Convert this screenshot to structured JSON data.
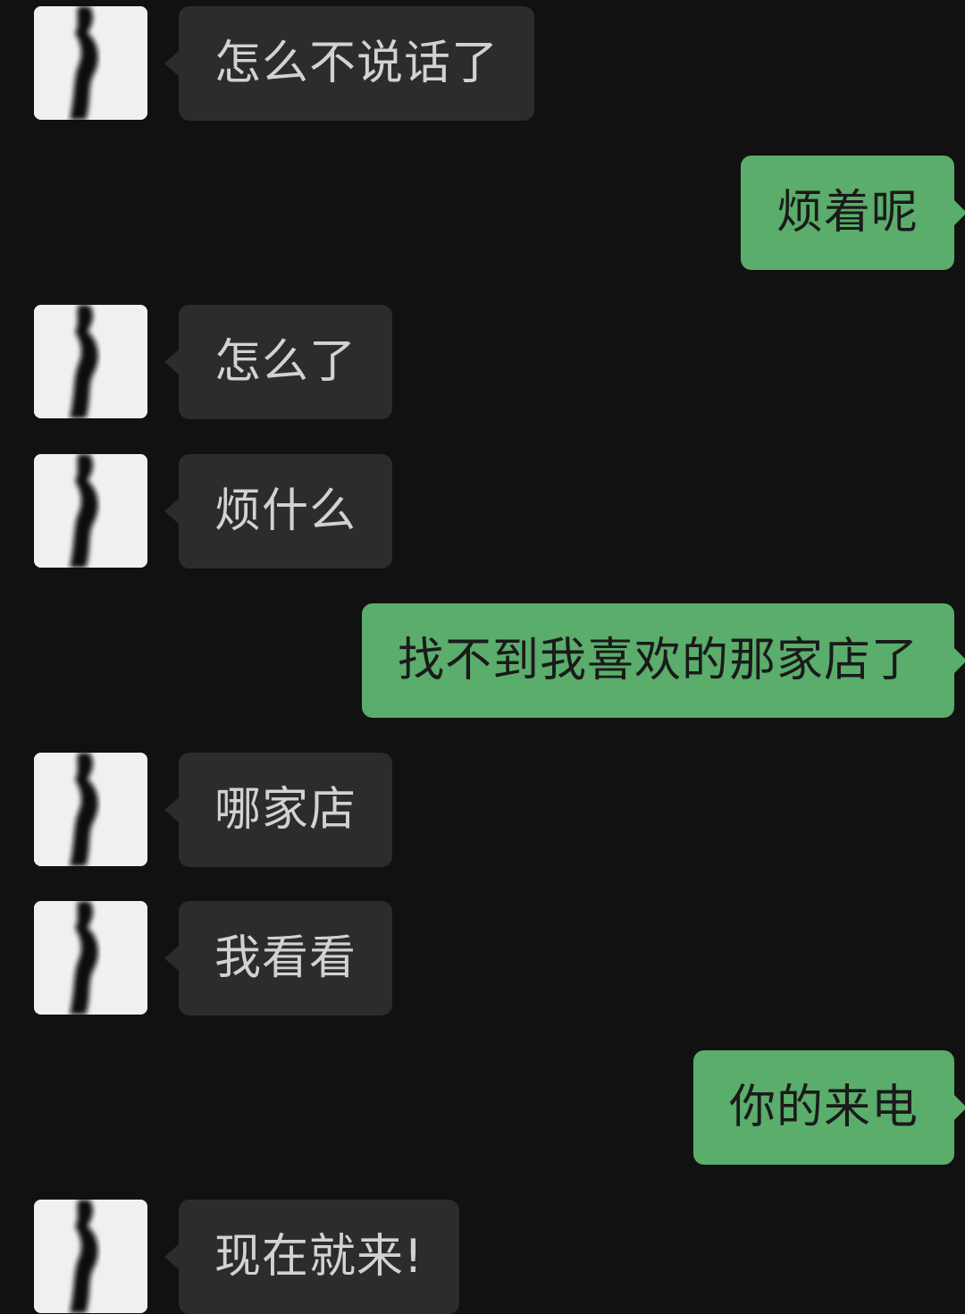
{
  "chat": {
    "messages": [
      {
        "sender": "other",
        "text": "怎么不说话了"
      },
      {
        "sender": "self",
        "text": "烦着呢"
      },
      {
        "sender": "other",
        "text": "怎么了"
      },
      {
        "sender": "other",
        "text": "烦什么"
      },
      {
        "sender": "self",
        "text": "找不到我喜欢的那家店了"
      },
      {
        "sender": "other",
        "text": "哪家店"
      },
      {
        "sender": "other",
        "text": "我看看"
      },
      {
        "sender": "self",
        "text": "你的来电"
      },
      {
        "sender": "other",
        "text": "现在就来!"
      }
    ]
  },
  "colors": {
    "background": "#111111",
    "incoming_bubble": "#2c2c2c",
    "incoming_text": "#d2d2d2",
    "outgoing_bubble": "#5aad6b",
    "outgoing_text": "#1a1a1a"
  }
}
